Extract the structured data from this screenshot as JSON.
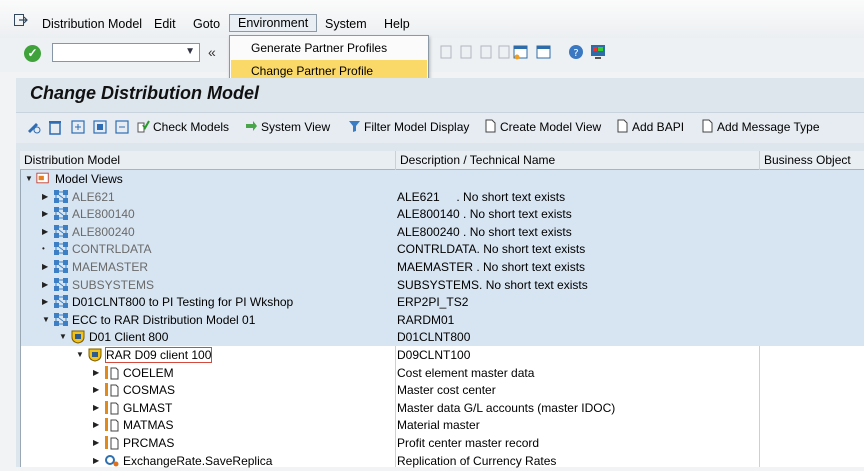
{
  "menu": {
    "items": [
      "Distribution Model",
      "Edit",
      "Goto",
      "Environment",
      "System",
      "Help"
    ],
    "dropdown": [
      "Generate Partner Profiles",
      "Change Partner Profile"
    ]
  },
  "page_title": "Change Distribution Model",
  "app_toolbar": {
    "check_models": "Check Models",
    "system_view": "System View",
    "filter_model_display": "Filter Model Display",
    "create_model_view": "Create Model View",
    "add_bapi": "Add BAPI",
    "add_message_type": "Add Message Type"
  },
  "tree": {
    "columns": [
      "Distribution Model",
      "Description / Technical Name",
      "Business Object"
    ],
    "rows": [
      {
        "name": "Model Views",
        "desc": ""
      },
      {
        "name": "ALE621",
        "desc": "ALE621     . No short text exists"
      },
      {
        "name": "ALE800140",
        "desc": "ALE800140 . No short text exists"
      },
      {
        "name": "ALE800240",
        "desc": "ALE800240 . No short text exists"
      },
      {
        "name": "CONTRLDATA",
        "desc": "CONTRLDATA. No short text exists"
      },
      {
        "name": "MAEMASTER",
        "desc": "MAEMASTER . No short text exists"
      },
      {
        "name": "SUBSYSTEMS",
        "desc": "SUBSYSTEMS. No short text exists"
      },
      {
        "name": "D01CLNT800 to PI Testing for PI Wkshop",
        "desc": "ERP2PI_TS2"
      },
      {
        "name": "ECC to RAR Distribution Model 01",
        "desc": "RARDM01"
      },
      {
        "name": "D01 Client 800",
        "desc": "D01CLNT800"
      },
      {
        "name": "RAR D09 client 100",
        "desc": "D09CLNT100"
      },
      {
        "name": "COELEM",
        "desc": "Cost element master data"
      },
      {
        "name": "COSMAS",
        "desc": "Master cost center"
      },
      {
        "name": "GLMAST",
        "desc": "Master data G/L accounts (master IDOC)"
      },
      {
        "name": "MATMAS",
        "desc": "Material master"
      },
      {
        "name": "PRCMAS",
        "desc": "Profit center master record"
      },
      {
        "name": "ExchangeRate.SaveReplica",
        "desc": "Replication of Currency Rates"
      }
    ]
  }
}
